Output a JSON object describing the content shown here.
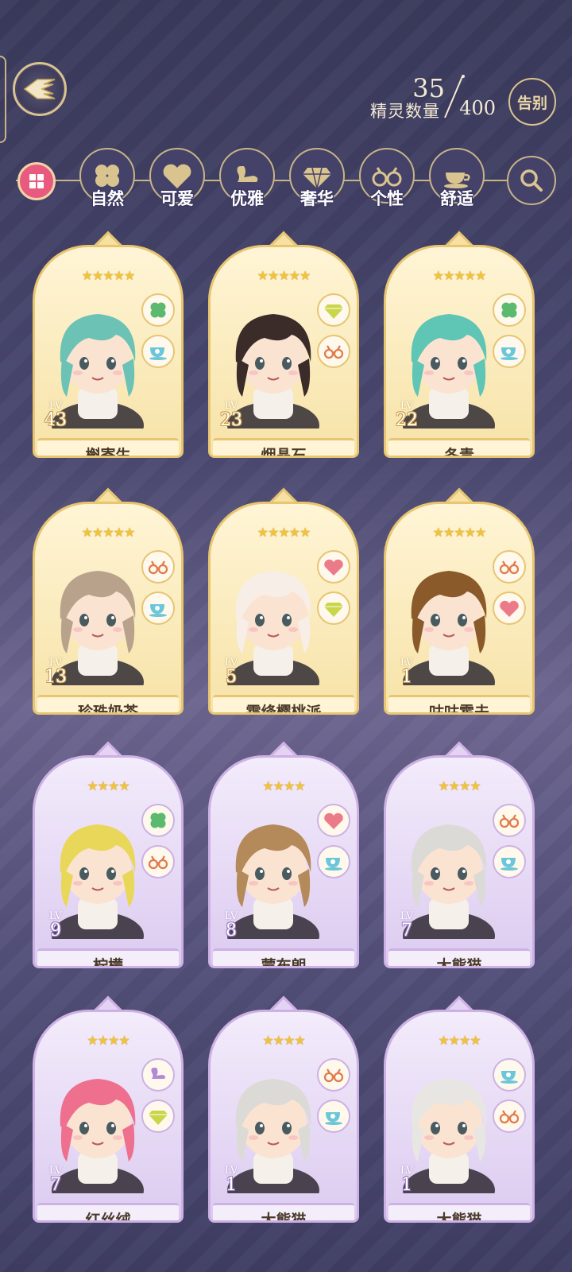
{
  "header": {
    "back_icon": "wing-back-icon",
    "spirit_count_label": "精灵数量",
    "spirit_count_current": "35",
    "spirit_count_max": "400",
    "farewell_label": "告别"
  },
  "filters": {
    "all_icon": "gift-grid-icon",
    "items": [
      {
        "label": "自然",
        "icon": "clover-icon"
      },
      {
        "label": "可爱",
        "icon": "heart-icon"
      },
      {
        "label": "优雅",
        "icon": "swan-icon"
      },
      {
        "label": "奢华",
        "icon": "diamond-icon"
      },
      {
        "label": "个性",
        "icon": "glasses-icon"
      },
      {
        "label": "舒适",
        "icon": "teacup-icon"
      }
    ],
    "search_icon": "search-icon"
  },
  "cards": [
    {
      "name": "槲寄生",
      "lv_tag": "LV",
      "level": "43",
      "stars": "★★★★★",
      "attrs": [
        "clover",
        "teacup"
      ],
      "tier": "gold",
      "hair": "#6cc2b4"
    },
    {
      "name": "烟晶石",
      "lv_tag": "LV",
      "level": "23",
      "stars": "★★★★★",
      "attrs": [
        "diamond",
        "glasses"
      ],
      "tier": "gold",
      "hair": "#3b2c2a"
    },
    {
      "name": "冬青",
      "lv_tag": "LV",
      "level": "22",
      "stars": "★★★★★",
      "attrs": [
        "clover",
        "teacup"
      ],
      "tier": "gold",
      "hair": "#5fc5b5"
    },
    {
      "name": "珍珠奶茶",
      "lv_tag": "LV",
      "level": "13",
      "stars": "★★★★★",
      "attrs": [
        "glasses",
        "teacup"
      ],
      "tier": "gold",
      "hair": "#b9a28c"
    },
    {
      "name": "霜绛樱桃派",
      "lv_tag": "LV",
      "level": "5",
      "stars": "★★★★★",
      "attrs": [
        "heart",
        "diamond"
      ],
      "tier": "gold",
      "hair": "#f7eee8"
    },
    {
      "name": "咕咕霍夫",
      "lv_tag": "LV",
      "level": "1",
      "stars": "★★★★★",
      "attrs": [
        "glasses",
        "heart"
      ],
      "tier": "gold",
      "hair": "#8a5a2a"
    },
    {
      "name": "柠檬",
      "lv_tag": "LV",
      "level": "9",
      "stars": "★★★★",
      "attrs": [
        "clover",
        "glasses"
      ],
      "tier": "purple",
      "hair": "#e9d75a"
    },
    {
      "name": "蒙布朗",
      "lv_tag": "LV",
      "level": "8",
      "stars": "★★★★",
      "attrs": [
        "heart",
        "teacup"
      ],
      "tier": "purple",
      "hair": "#b48a5a"
    },
    {
      "name": "大熊猫",
      "lv_tag": "LV",
      "level": "7",
      "stars": "★★★★",
      "attrs": [
        "glasses",
        "teacup"
      ],
      "tier": "purple",
      "hair": "#dcdad6"
    },
    {
      "name": "红丝绒",
      "lv_tag": "LV",
      "level": "7",
      "stars": "★★★★",
      "attrs": [
        "swan",
        "diamond"
      ],
      "tier": "purple",
      "hair": "#ee6f8e"
    },
    {
      "name": "大熊猫",
      "lv_tag": "LV",
      "level": "1",
      "stars": "★★★★",
      "attrs": [
        "glasses",
        "teacup"
      ],
      "tier": "purple",
      "hair": "#dcdad6"
    },
    {
      "name": "大熊猫",
      "lv_tag": "LV",
      "level": "1",
      "stars": "★★★★",
      "attrs": [
        "teacup",
        "glasses"
      ],
      "tier": "purple",
      "hair": "#e8e6e2"
    }
  ],
  "colors": {
    "gold_frame": "#e7c571",
    "purple_frame": "#cdb1e4",
    "accent_pink": "#e85a7e"
  }
}
